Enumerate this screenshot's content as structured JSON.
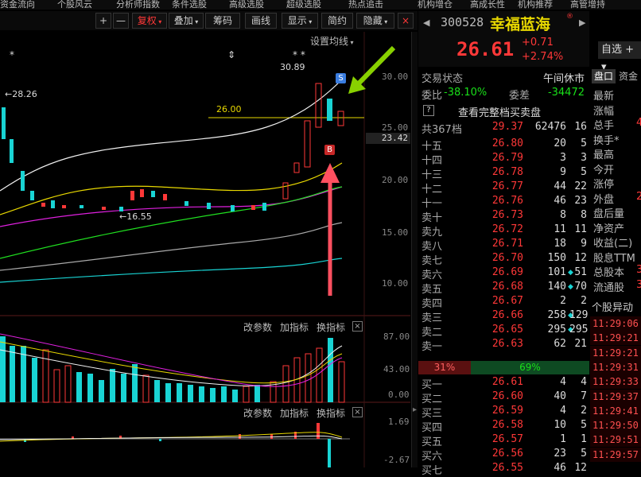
{
  "top_menu": [
    "资金流向",
    "个股风云",
    "分析师指数",
    "条件选股",
    "高级选股",
    "超级选股",
    "热点追击",
    "机构增仓",
    "高成长性",
    "机构推荐",
    "高管增持"
  ],
  "toolbar": {
    "plus": "+",
    "minus": "—",
    "fuquan": "复权",
    "overlay": "叠加",
    "chips": "筹码",
    "draw": "画线",
    "display": "显示",
    "simple": "简约",
    "hide": "隐藏"
  },
  "chart": {
    "setting_ma": "设置均线",
    "y_labels": [
      "30.00",
      "25.00",
      "20.00",
      "15.00",
      "10.00"
    ],
    "cur_price_label": "23.42",
    "high_label": "30.89",
    "hline_label": "26.00",
    "left_label": "28.26",
    "low_label": "16.55",
    "star1": "*",
    "star2": "* *",
    "arrow_mark": "⇕",
    "badge_s": "S",
    "badge_b": "B",
    "vol_header": [
      "改参数",
      "加指标",
      "换指标"
    ],
    "vol_labels": [
      "87.00",
      "43.00",
      "0.00"
    ],
    "macd_header": [
      "改参数",
      "加指标",
      "换指标"
    ],
    "macd_labels": [
      "1.69",
      "-2.67"
    ],
    "close_x": "×"
  },
  "stock": {
    "code": "300528",
    "name": "幸福蓝海",
    "price": "26.61",
    "change": "+0.71",
    "pct": "+2.74%"
  },
  "trade": {
    "status_label": "交易状态",
    "status_value": "午间休市",
    "weibi_label": "委比",
    "weibi_value": "-38.10%",
    "weicha_label": "委差",
    "weicha_value": "-34472",
    "full_book": "查看完整档买卖盘",
    "q_icon": "?",
    "total_label": "共367档",
    "total_price": "29.37",
    "total_vol": "62476",
    "total_cnt": "16",
    "asks": [
      {
        "label": "十五",
        "price": "26.80",
        "vol": "20",
        "cnt": "5"
      },
      {
        "label": "十四",
        "price": "26.79",
        "vol": "3",
        "cnt": "3"
      },
      {
        "label": "十三",
        "price": "26.78",
        "vol": "9",
        "cnt": "5"
      },
      {
        "label": "十二",
        "price": "26.77",
        "vol": "44",
        "cnt": "22"
      },
      {
        "label": "十一",
        "price": "26.76",
        "vol": "46",
        "cnt": "23"
      },
      {
        "label": "卖十",
        "price": "26.73",
        "vol": "8",
        "cnt": "8"
      },
      {
        "label": "卖九",
        "price": "26.72",
        "vol": "11",
        "cnt": "11"
      },
      {
        "label": "卖八",
        "price": "26.71",
        "vol": "18",
        "cnt": "9"
      },
      {
        "label": "卖七",
        "price": "26.70",
        "vol": "150",
        "cnt": "12"
      },
      {
        "label": "卖六",
        "price": "26.69",
        "vol": "101",
        "cnt": "51"
      },
      {
        "label": "卖五",
        "price": "26.68",
        "vol": "140",
        "cnt": "70"
      },
      {
        "label": "卖四",
        "price": "26.67",
        "vol": "2",
        "cnt": "2"
      },
      {
        "label": "卖三",
        "price": "26.66",
        "vol": "258",
        "cnt": "129"
      },
      {
        "label": "卖二",
        "price": "26.65",
        "vol": "295",
        "cnt": "295"
      },
      {
        "label": "卖一",
        "price": "26.63",
        "vol": "62",
        "cnt": "21"
      }
    ],
    "ratio_left": "31%",
    "ratio_right": "69%",
    "bids": [
      {
        "label": "买一",
        "price": "26.61",
        "vol": "4",
        "cnt": "4"
      },
      {
        "label": "买二",
        "price": "26.60",
        "vol": "40",
        "cnt": "7"
      },
      {
        "label": "买三",
        "price": "26.59",
        "vol": "4",
        "cnt": "2"
      },
      {
        "label": "买四",
        "price": "26.58",
        "vol": "10",
        "cnt": "5"
      },
      {
        "label": "买五",
        "price": "26.57",
        "vol": "1",
        "cnt": "1"
      },
      {
        "label": "买六",
        "price": "26.56",
        "vol": "23",
        "cnt": "5"
      },
      {
        "label": "买七",
        "price": "26.55",
        "vol": "46",
        "cnt": "12"
      }
    ]
  },
  "far": {
    "zixuan": "自选",
    "plus": "+",
    "tab1": "盘口",
    "tab2": "资金",
    "rows": [
      "最新",
      "涨幅",
      "总手",
      "换手*",
      "最高",
      "今开",
      "涨停",
      "外盘",
      "盘后量",
      "净资产",
      "收益(二)",
      "股息TTM",
      "总股本",
      "流通股"
    ],
    "row_vals": [
      "",
      "",
      "4",
      "",
      "",
      "",
      "",
      "2",
      "",
      "",
      "",
      "",
      "3",
      "3"
    ],
    "yidong": "个股异动",
    "times": [
      "11:29:06",
      "11:29:21",
      "11:29:21",
      "11:29:31",
      "11:29:33",
      "11:29:37",
      "11:29:41",
      "11:29:50",
      "11:29:51",
      "11:29:57"
    ]
  }
}
